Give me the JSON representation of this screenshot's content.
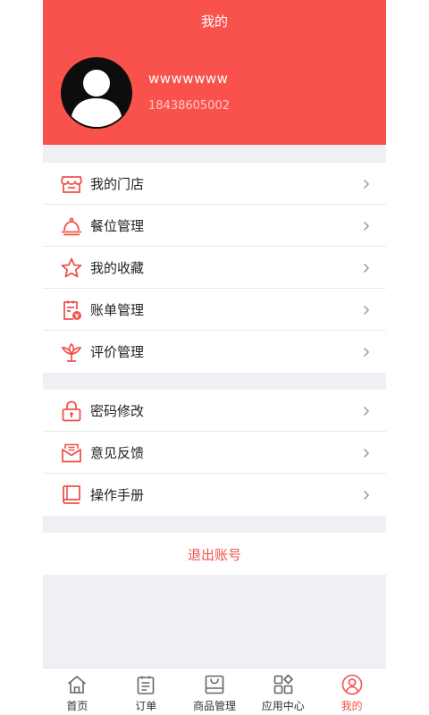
{
  "header": {
    "title": "我的",
    "username": "wwwwwww",
    "phone": "18438605002"
  },
  "menu_group_1": [
    {
      "label": "我的门店",
      "icon": "store-icon"
    },
    {
      "label": "餐位管理",
      "icon": "service-bell-icon"
    },
    {
      "label": "我的收藏",
      "icon": "star-icon"
    },
    {
      "label": "账单管理",
      "icon": "bill-icon"
    },
    {
      "label": "评价管理",
      "icon": "flower-icon"
    }
  ],
  "menu_group_2": [
    {
      "label": "密码修改",
      "icon": "lock-icon"
    },
    {
      "label": "意见反馈",
      "icon": "envelope-icon"
    },
    {
      "label": "操作手册",
      "icon": "book-icon"
    }
  ],
  "logout_label": "退出账号",
  "tabs": [
    {
      "label": "首页",
      "icon": "home-icon",
      "active": false
    },
    {
      "label": "订单",
      "icon": "order-icon",
      "active": false
    },
    {
      "label": "商品管理",
      "icon": "goods-icon",
      "active": false
    },
    {
      "label": "应用中心",
      "icon": "apps-icon",
      "active": false
    },
    {
      "label": "我的",
      "icon": "profile-icon",
      "active": true
    }
  ],
  "colors": {
    "brand_red": "#f9524c",
    "accent_red": "#f0524c",
    "background": "#f0eff4"
  }
}
